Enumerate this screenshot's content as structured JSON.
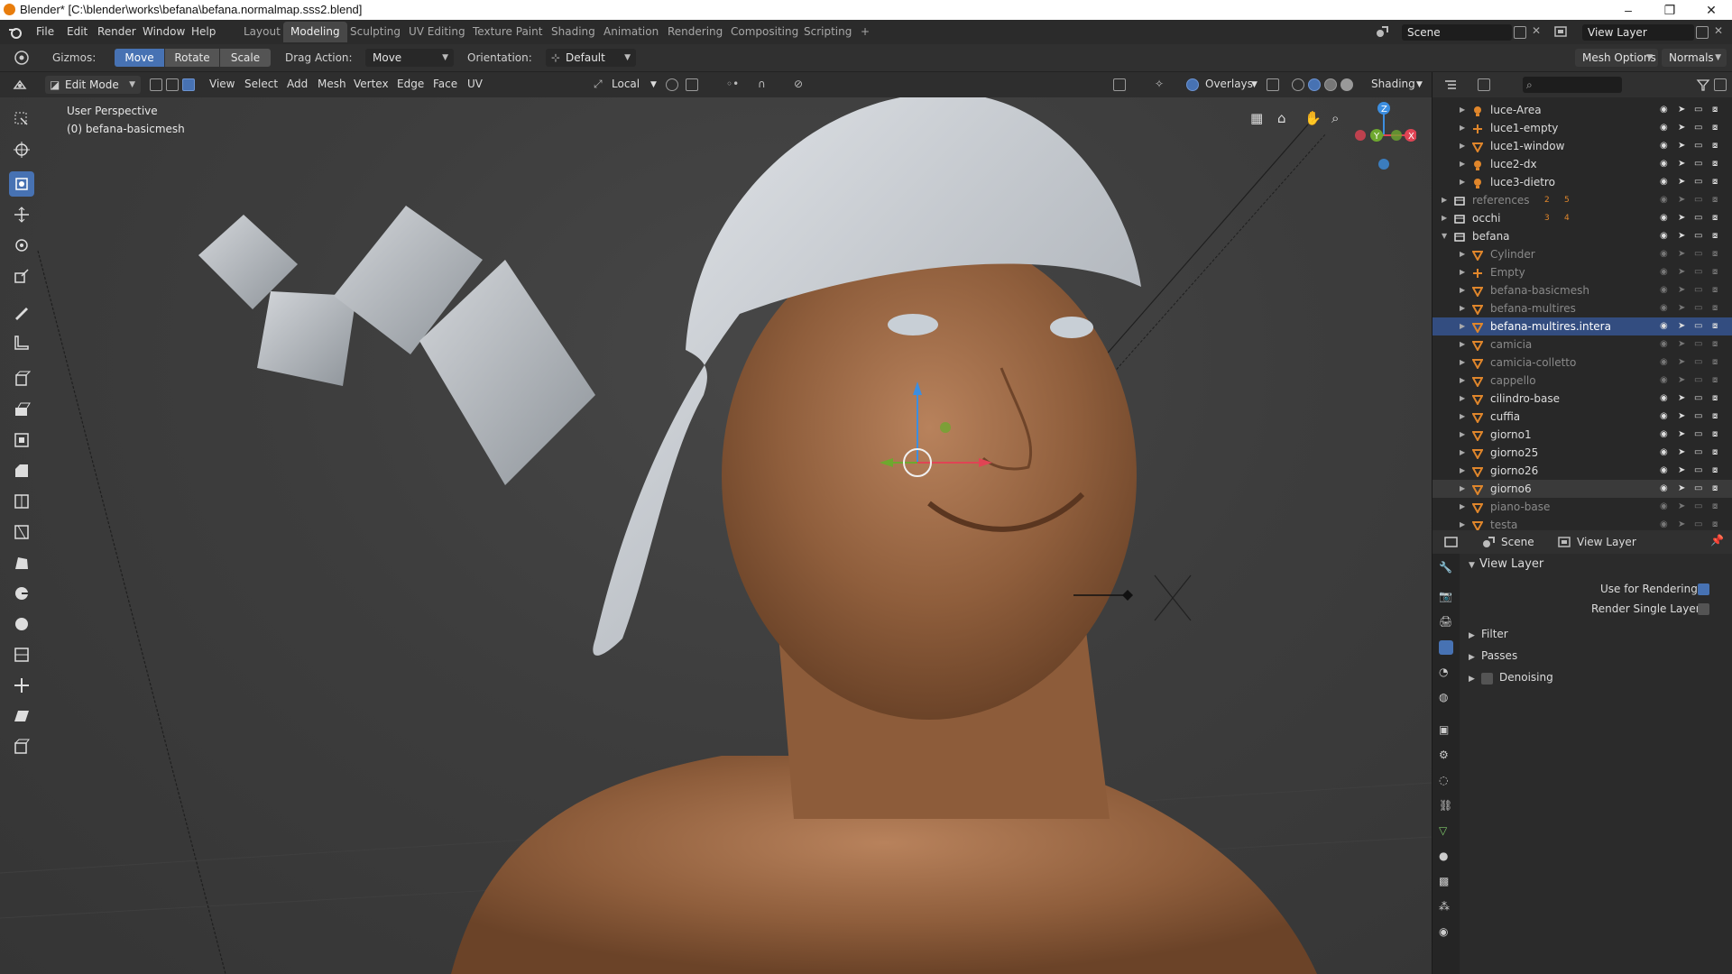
{
  "window": {
    "title": "Blender* [C:\\blender\\works\\befana\\befana.normalmap.sss2.blend]",
    "controls": [
      "–",
      "❐",
      "✕"
    ]
  },
  "menu": [
    "File",
    "Edit",
    "Render",
    "Window",
    "Help"
  ],
  "workspaces": [
    "Layout",
    "Modeling",
    "Sculpting",
    "UV Editing",
    "Texture Paint",
    "Shading",
    "Animation",
    "Rendering",
    "Compositing",
    "Scripting",
    "+"
  ],
  "active_workspace": "Modeling",
  "scene": {
    "label": "Scene",
    "view_layer": "View Layer"
  },
  "tool_settings": {
    "gizmos_label": "Gizmos:",
    "gizmo_buttons": [
      "Move",
      "Rotate",
      "Scale"
    ],
    "active_gizmo": "Move",
    "drag_action_label": "Drag Action:",
    "drag_action_value": "Move",
    "orientation_label": "Orientation:",
    "orientation_value": "Default",
    "mesh_options": "Mesh Options",
    "normals": "Normals"
  },
  "viewport_header": {
    "mode": "Edit Mode",
    "menus": [
      "View",
      "Select",
      "Add",
      "Mesh",
      "Vertex",
      "Edge",
      "Face",
      "UV"
    ],
    "transform_space": "Local",
    "overlays": "Overlays",
    "shading": "Shading"
  },
  "viewport": {
    "perspective": "User Perspective",
    "object_info": "(0) befana-basicmesh",
    "gizmo_axes": [
      "Z",
      "Y",
      "X"
    ]
  },
  "outliner": {
    "search_placeholder": "",
    "rows": [
      {
        "name": "luce-Area",
        "type": "light",
        "depth": 2,
        "dim": false
      },
      {
        "name": "luce1-empty",
        "type": "empty",
        "depth": 2,
        "dim": false
      },
      {
        "name": "luce1-window",
        "type": "mesh",
        "depth": 2,
        "dim": false
      },
      {
        "name": "luce2-dx",
        "type": "light",
        "depth": 2,
        "dim": false
      },
      {
        "name": "luce3-dietro",
        "type": "light",
        "depth": 2,
        "dim": false
      },
      {
        "name": "references",
        "type": "collection",
        "depth": 1,
        "dim": true,
        "badges": [
          "2",
          "5"
        ]
      },
      {
        "name": "occhi",
        "type": "collection",
        "depth": 1,
        "dim": false,
        "badges": [
          "3",
          "4"
        ]
      },
      {
        "name": "befana",
        "type": "collection",
        "depth": 1,
        "dim": false,
        "expanded": true
      },
      {
        "name": "Cylinder",
        "type": "mesh",
        "depth": 2,
        "dim": true
      },
      {
        "name": "Empty",
        "type": "empty",
        "depth": 2,
        "dim": true
      },
      {
        "name": "befana-basicmesh",
        "type": "mesh",
        "depth": 2,
        "dim": true
      },
      {
        "name": "befana-multires",
        "type": "mesh",
        "depth": 2,
        "dim": true
      },
      {
        "name": "befana-multires.intera",
        "type": "mesh",
        "depth": 2,
        "dim": false,
        "selected": true
      },
      {
        "name": "camicia",
        "type": "mesh",
        "depth": 2,
        "dim": true
      },
      {
        "name": "camicia-colletto",
        "type": "mesh",
        "depth": 2,
        "dim": true
      },
      {
        "name": "cappello",
        "type": "mesh",
        "depth": 2,
        "dim": true
      },
      {
        "name": "cilindro-base",
        "type": "mesh",
        "depth": 2,
        "dim": false
      },
      {
        "name": "cuffia",
        "type": "mesh",
        "depth": 2,
        "dim": false
      },
      {
        "name": "giorno1",
        "type": "mesh",
        "depth": 2,
        "dim": false
      },
      {
        "name": "giorno25",
        "type": "mesh",
        "depth": 2,
        "dim": false
      },
      {
        "name": "giorno26",
        "type": "mesh",
        "depth": 2,
        "dim": false
      },
      {
        "name": "giorno6",
        "type": "mesh",
        "depth": 2,
        "dim": false,
        "hover": true
      },
      {
        "name": "piano-base",
        "type": "mesh",
        "depth": 2,
        "dim": true
      },
      {
        "name": "testa",
        "type": "mesh",
        "depth": 2,
        "dim": true
      }
    ]
  },
  "properties": {
    "scene_label": "Scene",
    "view_layer_label": "View Layer",
    "panel_title": "View Layer",
    "use_for_rendering_label": "Use for Rendering",
    "use_for_rendering": true,
    "render_single_layer_label": "Render Single Layer",
    "render_single_layer": false,
    "subpanels": [
      "Filter",
      "Passes",
      "Denoising"
    ]
  },
  "colors": {
    "accent": "#4772b3",
    "selection_row": "#334d80",
    "object_orange": "#e0862b",
    "mesh_green": "#7ec86a",
    "axis_x": "#e04454",
    "axis_y": "#6ea82f",
    "axis_z": "#3c8ee0"
  }
}
